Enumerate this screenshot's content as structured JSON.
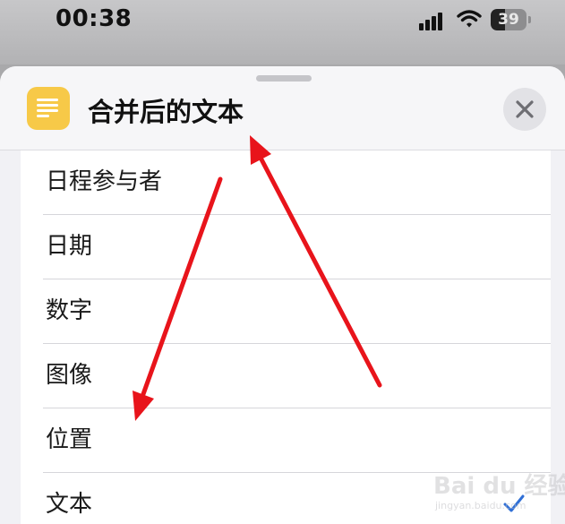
{
  "status_bar": {
    "time": "00:38",
    "battery_level": "39",
    "icons": [
      "cellular-signal-icon",
      "wifi-icon",
      "battery-icon"
    ]
  },
  "sheet": {
    "title": "合并后的文本",
    "app_icon": "text-lines-icon",
    "close_icon": "close-icon",
    "colors": {
      "app_icon_background": "#f7c948",
      "checkmark": "#2f6fd6",
      "annotation_arrows": "#e8141b"
    }
  },
  "list": {
    "items": [
      {
        "label": "日程参与者",
        "selected": false
      },
      {
        "label": "日期",
        "selected": false
      },
      {
        "label": "数字",
        "selected": false
      },
      {
        "label": "图像",
        "selected": false
      },
      {
        "label": "位置",
        "selected": false
      },
      {
        "label": "文本",
        "selected": true
      }
    ]
  },
  "watermark": {
    "logo": "Bai du 经验",
    "url": "jingyan.baidu.com"
  }
}
